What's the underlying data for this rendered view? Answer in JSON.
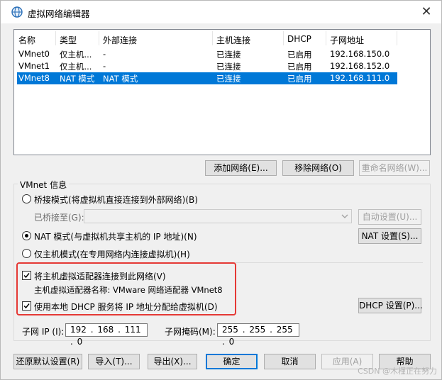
{
  "window": {
    "title": "虚拟网络编辑器",
    "close_glyph": "✕"
  },
  "table": {
    "headers": [
      "名称",
      "类型",
      "外部连接",
      "主机连接",
      "DHCP",
      "子网地址"
    ],
    "rows": [
      {
        "name": "VMnet0",
        "type": "仅主机...",
        "external": "-",
        "host": "已连接",
        "dhcp": "已启用",
        "subnet": "192.168.150.0",
        "selected": false
      },
      {
        "name": "VMnet1",
        "type": "仅主机...",
        "external": "-",
        "host": "已连接",
        "dhcp": "已启用",
        "subnet": "192.168.152.0",
        "selected": false
      },
      {
        "name": "VMnet8",
        "type": "NAT 模式",
        "external": "NAT 模式",
        "host": "已连接",
        "dhcp": "已启用",
        "subnet": "192.168.111.0",
        "selected": true
      }
    ]
  },
  "list_buttons": {
    "add": "添加网络(E)...",
    "remove": "移除网络(O)",
    "rename": "重命名网络(W)..."
  },
  "vmnet_info": {
    "group_title": "VMnet 信息",
    "bridged_label": "桥接模式(将虚拟机直接连接到外部网络)(B)",
    "bridged_to_label": "已桥接至(G):",
    "bridged_to_value": "",
    "auto_settings": "自动设置(U)...",
    "nat_label": "NAT 模式(与虚拟机共享主机的 IP 地址)(N)",
    "nat_settings": "NAT 设置(S)...",
    "hostonly_label": "仅主机模式(在专用网络内连接虚拟机)(H)",
    "selected_mode": "nat",
    "connect_adapter_label": "将主机虚拟适配器连接到此网络(V)",
    "connect_adapter_checked": true,
    "adapter_name_label": "主机虚拟适配器名称: VMware 网络适配器 VMnet8",
    "use_dhcp_label": "使用本地 DHCP 服务将 IP 地址分配给虚拟机(D)",
    "use_dhcp_checked": true,
    "dhcp_settings": "DHCP 设置(P)...",
    "subnet_ip_label": "子网 IP (I):",
    "subnet_ip_value": "192 . 168 . 111 .  0",
    "subnet_mask_label": "子网掩码(M):",
    "subnet_mask_value": "255 . 255 . 255 .  0"
  },
  "footer": {
    "restore": "还原默认设置(R)",
    "import": "导入(T)...",
    "export": "导出(X)...",
    "ok": "确定",
    "cancel": "取消",
    "apply": "应用(A)",
    "help": "帮助"
  },
  "watermark": "CSDN @木槿正在努力",
  "colors": {
    "selection": "#0078d7",
    "highlight_box": "#e53935"
  }
}
